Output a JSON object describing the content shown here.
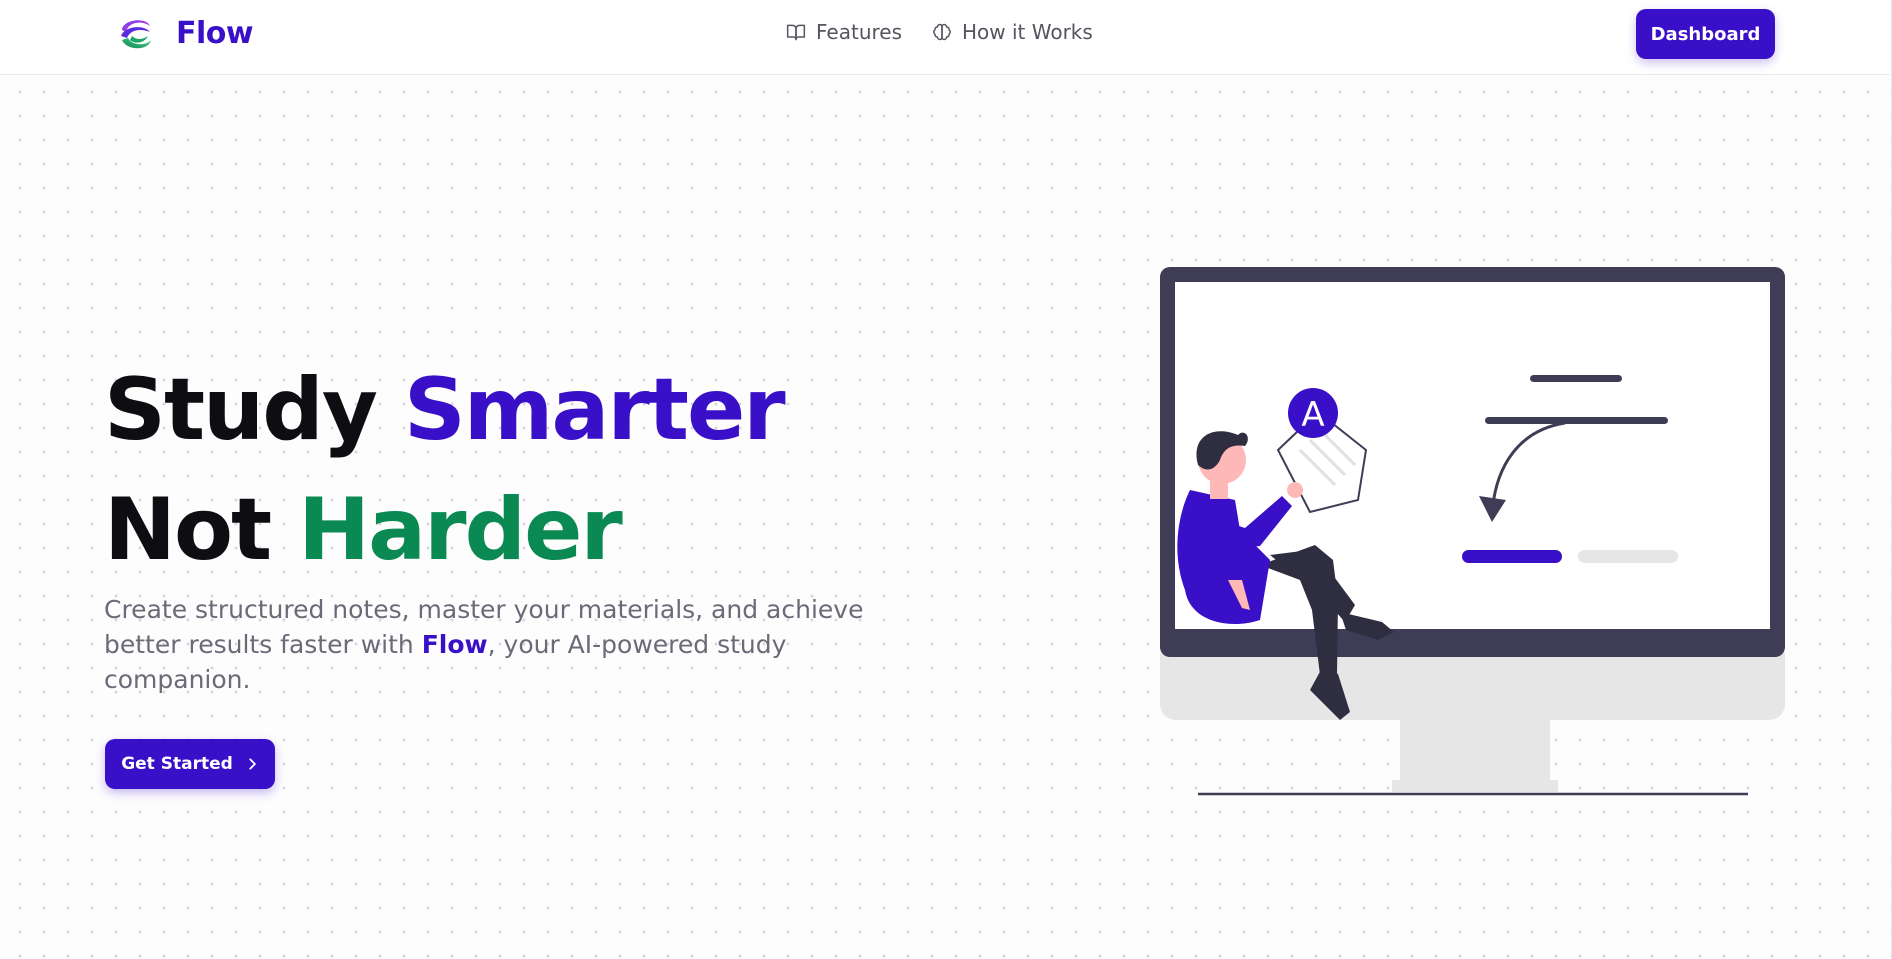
{
  "header": {
    "brand": "Flow",
    "nav": [
      {
        "label": "Features",
        "icon": "book-open-icon"
      },
      {
        "label": "How it Works",
        "icon": "brain-icon"
      }
    ],
    "dashboard_label": "Dashboard"
  },
  "hero": {
    "headline_line1_plain": "Study ",
    "headline_line1_accent": "Smarter",
    "headline_line2_plain": "Not ",
    "headline_line2_accent": "Harder",
    "subtext_before": "Create structured notes, master your materials, and achieve better results faster with ",
    "subtext_brand": "Flow",
    "subtext_after": ", your AI-powered study companion.",
    "cta_label": "Get Started",
    "illustration_letter": "A"
  },
  "colors": {
    "primary": "#3a0fc8",
    "accent_green": "#0a8a52",
    "monitor_dark": "#3f3d56",
    "monitor_base": "#e6e6e6"
  }
}
